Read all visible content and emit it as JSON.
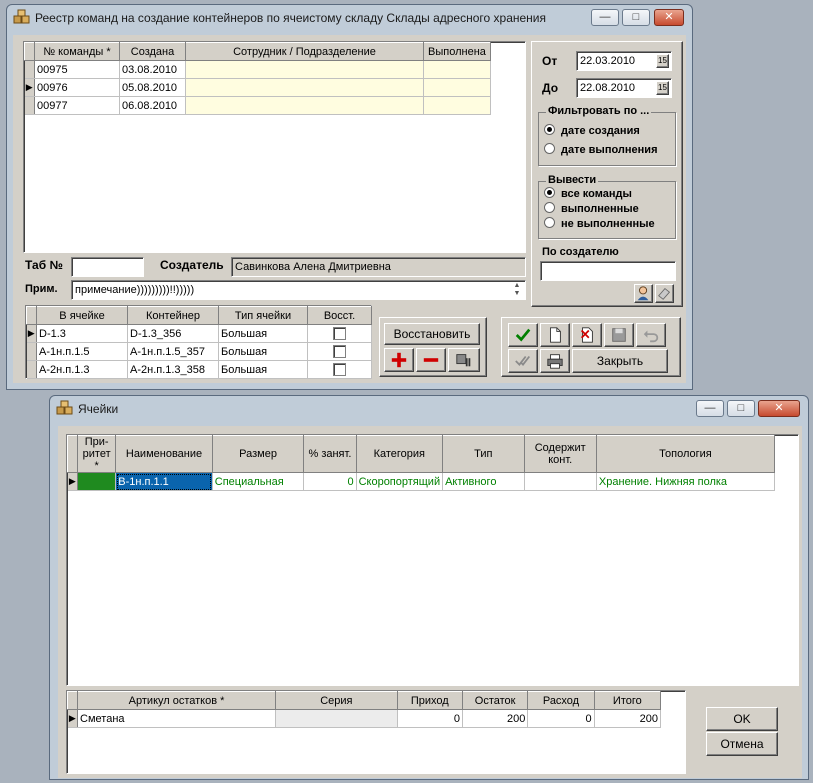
{
  "win1": {
    "title": "Реестр команд на создание контейнеров по ячеистому складу Склады адресного хранения",
    "controls": {
      "min": "—",
      "max": "□",
      "close": "✕"
    },
    "grid": {
      "headers": [
        "№ команды *",
        "Создана",
        "Сотрудник / Подразделение",
        "Выполнена"
      ],
      "rows": [
        {
          "num": "00975",
          "date": "03.08.2010",
          "emp": "",
          "done": ""
        },
        {
          "num": "00976",
          "date": "05.08.2010",
          "emp": "",
          "done": ""
        },
        {
          "num": "00977",
          "date": "06.08.2010",
          "emp": "",
          "done": ""
        }
      ],
      "current_row_marker": "▶"
    },
    "tab_label": "Таб №",
    "tab_value": "",
    "creator_label": "Создатель",
    "creator_value": "Савинкова Алена Дмитриевна",
    "note_label": "Прим.",
    "note_value": "примечание)))))))))!!)))))",
    "from_label": "От",
    "from_value": "22.03.2010",
    "to_label": "До",
    "to_value": "22.08.2010",
    "calendar_glyph": "15",
    "filter_title": "Фильтровать по ...",
    "filter_options": [
      "дате создания",
      "дате выполнения"
    ],
    "show_title": "Вывести",
    "show_options": [
      "все команды",
      "выполненные",
      "не выполненные"
    ],
    "by_creator_label": "По создателю",
    "by_creator_value": "",
    "cells": {
      "headers": [
        "В ячейке",
        "Контейнер",
        "Тип ячейки",
        "Восст."
      ],
      "rows": [
        {
          "cell": "D-1.3",
          "container": "D-1.3_356",
          "type": "Большая"
        },
        {
          "cell": "A-1н.п.1.5",
          "container": "A-1н.п.1.5_357",
          "type": "Большая"
        },
        {
          "cell": "A-2н.п.1.3",
          "container": "A-2н.п.1.3_358",
          "type": "Большая"
        }
      ]
    },
    "restore_label": "Восстановить",
    "close_label": "Закрыть",
    "colors": {
      "accent_green": "#008000",
      "add_red": "#d00000"
    }
  },
  "win2": {
    "title": "Ячейки",
    "controls": {
      "min": "—",
      "max": "□",
      "close": "✕"
    },
    "grid": {
      "headers": [
        "При-\nритет *",
        "Наименование",
        "Размер",
        "% занят.",
        "Категория",
        "Тип",
        "Содержит\nконт.",
        "Топология"
      ],
      "rows": [
        {
          "priority": "",
          "name": "B-1н.п.1.1",
          "size": "Специальная",
          "busy": "0",
          "category": "Скоропортящий",
          "type": "Активного",
          "contains": "",
          "topology": "Хранение. Нижняя полка"
        }
      ]
    },
    "stock": {
      "headers": [
        "Артикул остатков *",
        "Серия",
        "Приход",
        "Остаток",
        "Расход",
        "Итого"
      ],
      "rows": [
        {
          "article": "Сметана",
          "series": "",
          "income": "0",
          "balance": "200",
          "expense": "0",
          "total": "200"
        }
      ]
    },
    "ok_label": "OK",
    "cancel_label": "Отмена",
    "colors": {
      "priority_green": "#1f8a1f"
    }
  }
}
